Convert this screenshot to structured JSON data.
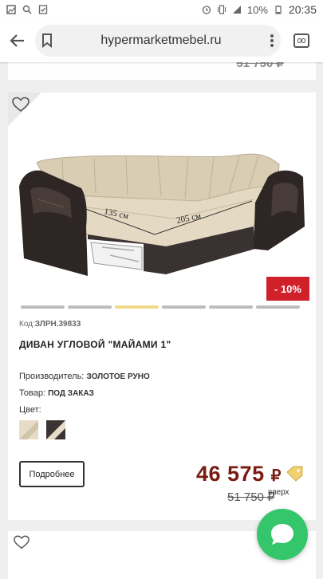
{
  "status_bar": {
    "battery": "10%",
    "time": "20:35",
    "icons": [
      "gallery-icon",
      "search-icon",
      "checkbox-icon",
      "alarm-icon",
      "vibrate-icon",
      "signal-icon",
      "battery-icon"
    ]
  },
  "browser": {
    "url": "hypermarketmebel.ru",
    "icons": [
      "back-arrow-icon",
      "bookmark-icon",
      "more-vertical-icon",
      "tabs-icon"
    ]
  },
  "previous_card": {
    "old_price": "51 750 ₽"
  },
  "product": {
    "code_label": "Код:",
    "code_value": "ЗЛРН.39833",
    "title": "ДИВАН УГЛОВОЙ \"МАЙАМИ 1\"",
    "discount_badge": "- 10%",
    "manufacturer_label": "Производитель:",
    "manufacturer_value": "ЗОЛОТОЕ РУНО",
    "goods_label": "Товар:",
    "goods_value": "ПОД ЗАКАЗ",
    "color_label": "Цвет:",
    "more_button": "Подробнее",
    "price": "46 575",
    "currency": "₽",
    "old_price": "51 750 ₽",
    "top_label": "вверх",
    "gallery_active_index": 2,
    "gallery_count": 6,
    "photo_labels": {
      "dim1": "135 см",
      "dim2": "205 см"
    },
    "colors": {
      "accent_price": "#7a1c12",
      "badge": "#d0202a",
      "chat": "#35c66b",
      "swatch_beige": "#e6dcc8",
      "swatch_dark": "#3a3533"
    }
  }
}
